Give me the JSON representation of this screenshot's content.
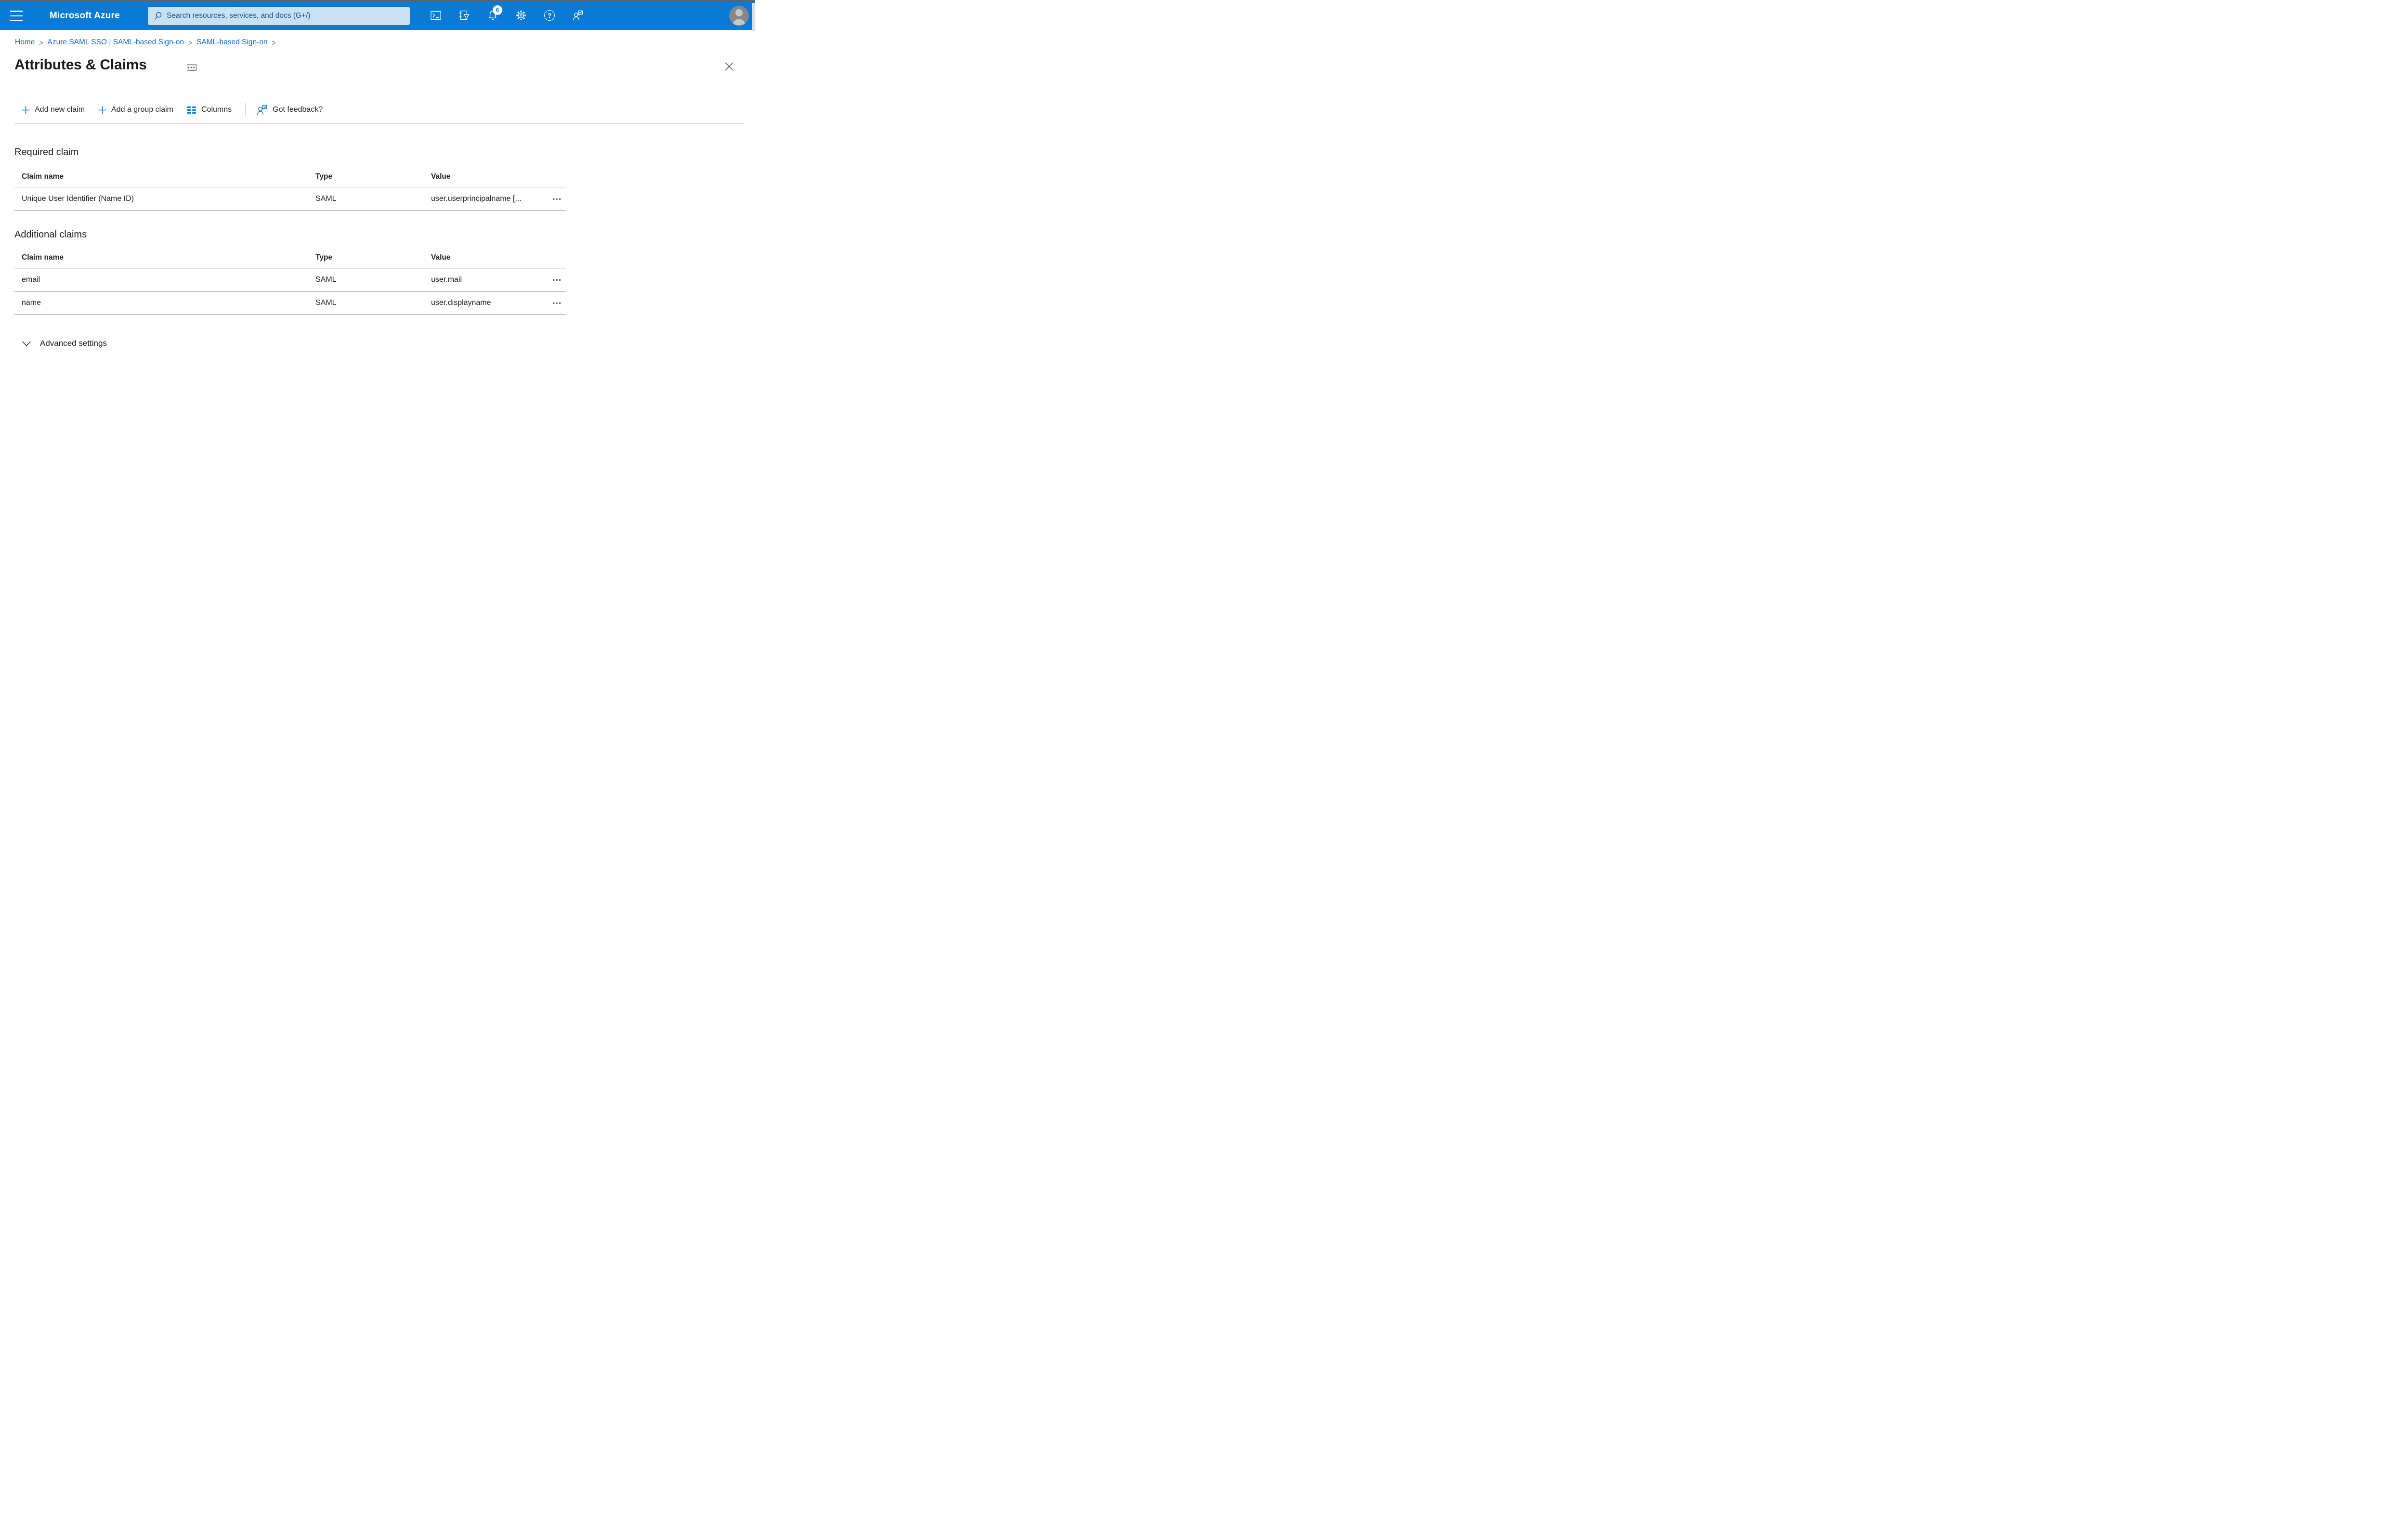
{
  "topbar": {
    "brand": "Microsoft Azure",
    "search_placeholder": "Search resources, services, and docs (G+/)",
    "notification_count": "6",
    "help_glyph": "?",
    "colors": {
      "bar": "#0b7ad4",
      "search_bg": "#c8e1f5",
      "search_text": "#11568f",
      "badge_bg": "#ffffff",
      "badge_text": "#0b7ad4"
    }
  },
  "breadcrumb": {
    "separator": ">",
    "items": [
      {
        "label": "Home"
      },
      {
        "label": "Azure SAML SSO | SAML-based Sign-on"
      },
      {
        "label": "SAML-based Sign-on"
      }
    ]
  },
  "page": {
    "title": "Attributes & Claims"
  },
  "ui": {
    "more_glyph": "•••"
  },
  "toolbar": {
    "items": [
      {
        "label": "Add new claim",
        "icon": "plus-icon"
      },
      {
        "label": "Add a group claim",
        "icon": "plus-icon"
      },
      {
        "label": "Columns",
        "icon": "columns-icon"
      },
      {
        "label": "Got feedback?",
        "icon": "feedback-icon"
      }
    ]
  },
  "sections": [
    {
      "heading": "Required claim",
      "columns": [
        "Claim name",
        "Type",
        "Value"
      ],
      "rows": [
        {
          "claim_name": "Unique User Identifier (Name ID)",
          "type": "SAML",
          "value": "user.userprincipalname [..."
        }
      ]
    },
    {
      "heading": "Additional claims",
      "columns": [
        "Claim name",
        "Type",
        "Value"
      ],
      "rows": [
        {
          "claim_name": "email",
          "type": "SAML",
          "value": "user.mail"
        },
        {
          "claim_name": "name",
          "type": "SAML",
          "value": "user.displayname"
        }
      ]
    }
  ],
  "advanced": {
    "label": "Advanced settings"
  },
  "colors": {
    "accent": "#0078d4",
    "topbar_blue": "#0b7ad4",
    "link": "#0c6dca",
    "title_text": "#1b1a19",
    "body_text": "#201f1e",
    "row_border": "#c8c6c4",
    "header_border": "#e8e6e4"
  }
}
